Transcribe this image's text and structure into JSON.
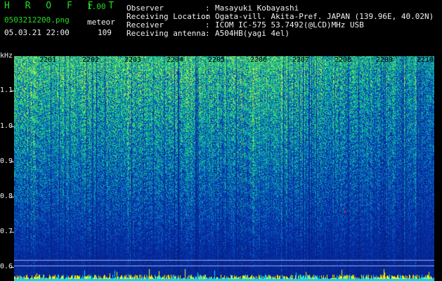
{
  "header": {
    "title": "H R O F F T",
    "version": "1.00",
    "filename": "0503212200.png",
    "mode": "meteor",
    "datetime": "05.03.21 22:00",
    "count": "109",
    "fields": [
      {
        "label": "Observer",
        "sep": ":",
        "value": "Masayuki Kobayashi"
      },
      {
        "label": "Receiving Location",
        "sep": ":",
        "value": "Ogata-vill. Akita-Pref. JAPAN (139.96E, 40.02N)"
      },
      {
        "label": "Receiver",
        "sep": ":",
        "value": "ICOM IC-575 53.7492(@LCD)MHz USB"
      },
      {
        "label": "Receiving antenna",
        "sep": ":",
        "value": "A504HB(yagi 4el)"
      }
    ]
  },
  "axis": {
    "y_unit": "kHz",
    "y_labels": [
      "1.1",
      "1.0",
      "0.9",
      "0.8",
      "0.7",
      "0.6"
    ],
    "x_labels": [
      "2201",
      "2202",
      "2203",
      "2204",
      "2205",
      "2206",
      "2207",
      "2208",
      "2209",
      "2210"
    ]
  },
  "colors": {
    "background": "#000000",
    "header_green": "#22dd22",
    "header_white": "#f2f2f2",
    "spectrum_low": "#0a1e7a",
    "spectrum_high": "#22ee66",
    "baseline": "#ffee00"
  }
}
